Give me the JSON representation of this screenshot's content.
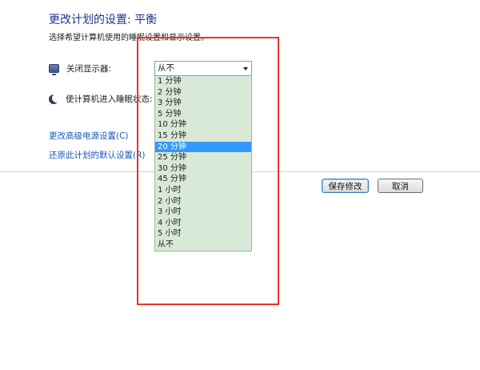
{
  "title": "更改计划的设置: 平衡",
  "subtitle": "选择希望计算机使用的睡眠设置和显示设置。",
  "settings": {
    "display_label": "关闭显示器:",
    "display_icon": "monitor-icon",
    "sleep_label": "使计算机进入睡眠状态:",
    "sleep_icon": "moon-icon"
  },
  "dropdown": {
    "selected": "从不",
    "highlighted_option": "20 分钟",
    "options": [
      "1 分钟",
      "2 分钟",
      "3 分钟",
      "5 分钟",
      "10 分钟",
      "15 分钟",
      "20 分钟",
      "25 分钟",
      "30 分钟",
      "45 分钟",
      "1 小时",
      "2 小时",
      "3 小时",
      "4 小时",
      "5 小时",
      "从不"
    ]
  },
  "links": {
    "advanced": "更改高级电源设置(C)",
    "restore": "还原此计划的默认设置(R)"
  },
  "buttons": {
    "save": "保存修改",
    "cancel": "取消"
  },
  "colors": {
    "title": "#1e3287",
    "link": "#1a58b5",
    "list_bg": "#d8ead7",
    "selection": "#3399ff",
    "annotation_box": "#e8322f"
  }
}
